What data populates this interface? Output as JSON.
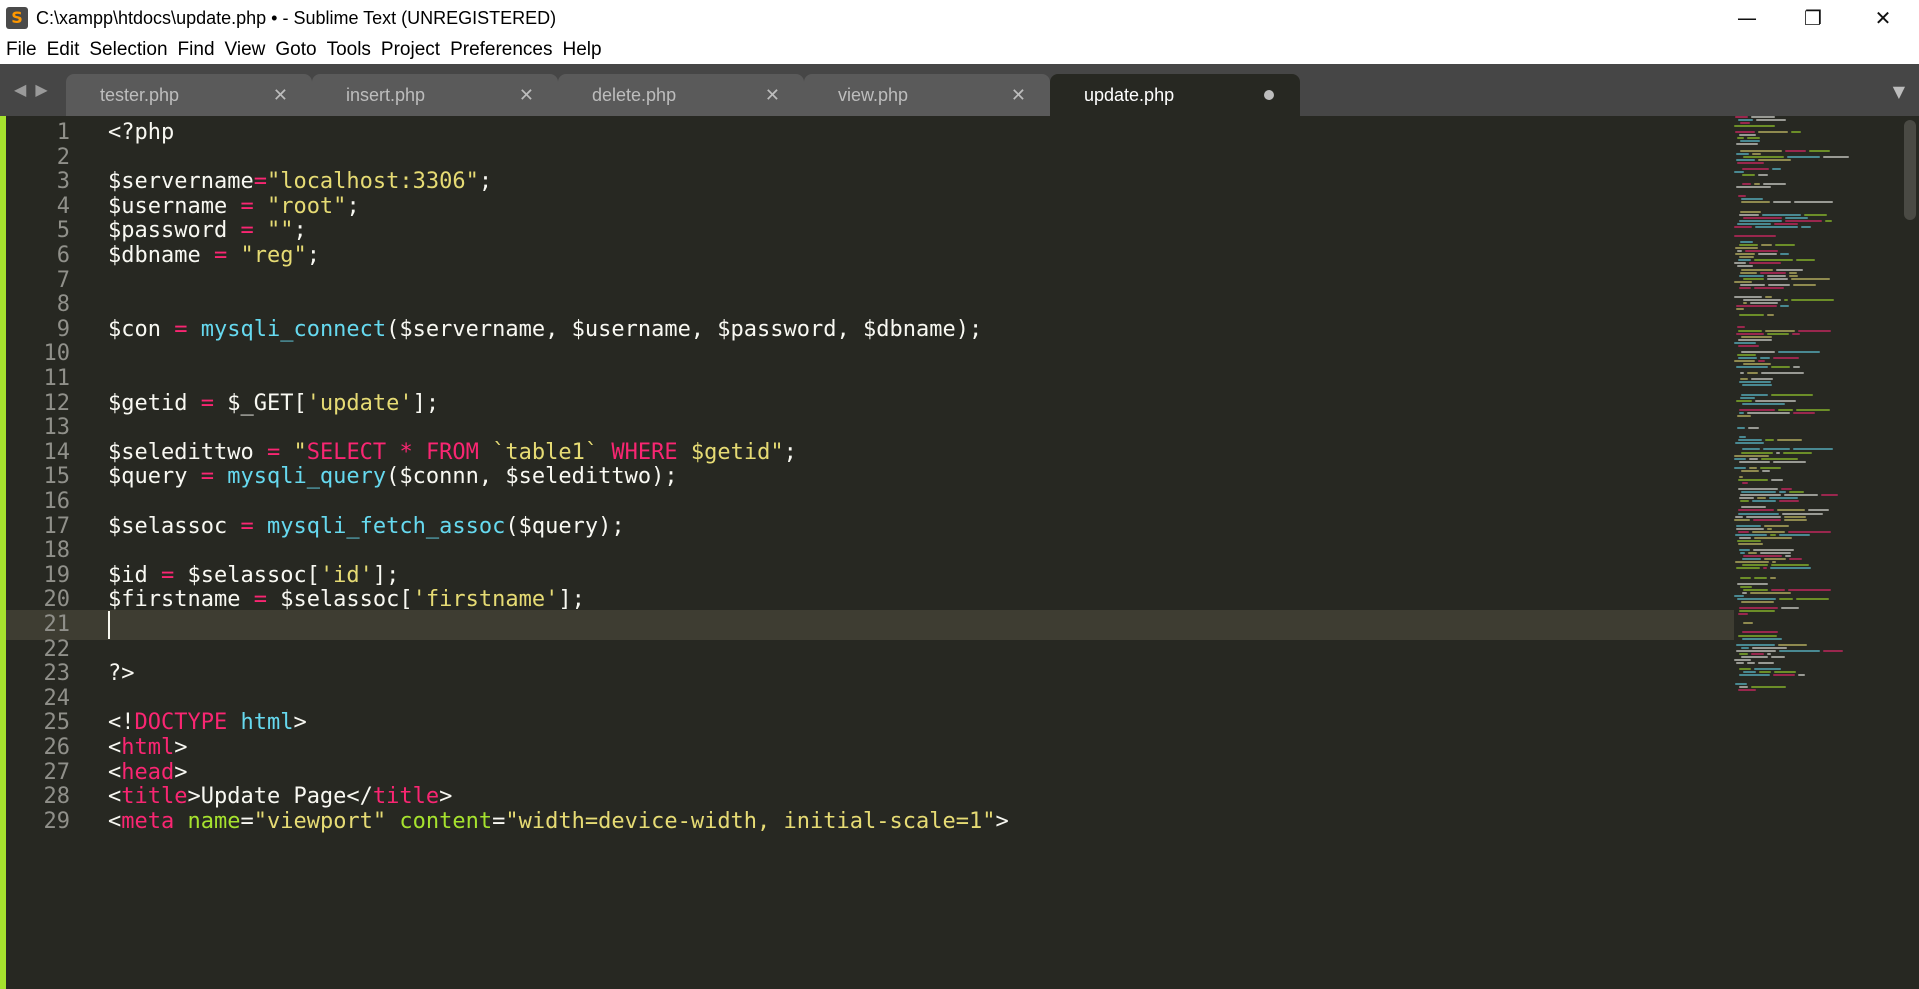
{
  "window": {
    "title": "C:\\xampp\\htdocs\\update.php • - Sublime Text (UNREGISTERED)",
    "app_icon_glyph": "S",
    "controls": {
      "minimize": "—",
      "maximize": "❐",
      "close": "✕"
    }
  },
  "menu": [
    "File",
    "Edit",
    "Selection",
    "Find",
    "View",
    "Goto",
    "Tools",
    "Project",
    "Preferences",
    "Help"
  ],
  "tabs": {
    "nav_glyph": "◀ ▶",
    "dropdown_glyph": "▼",
    "close_glyph": "✕",
    "items": [
      {
        "label": "tester.php",
        "active": false
      },
      {
        "label": "insert.php",
        "active": false
      },
      {
        "label": "delete.php",
        "active": false
      },
      {
        "label": "view.php",
        "active": false
      },
      {
        "label": "update.php",
        "active": true,
        "modified": true
      }
    ]
  },
  "editor": {
    "current_line": 21,
    "lines": [
      {
        "n": "1",
        "tokens": [
          [
            "<?php",
            "var"
          ]
        ]
      },
      {
        "n": "2",
        "tokens": []
      },
      {
        "n": "3",
        "tokens": [
          [
            "$servername",
            "var"
          ],
          [
            "=",
            "op"
          ],
          [
            "\"localhost:3306\"",
            "str"
          ],
          [
            ";",
            "var"
          ]
        ]
      },
      {
        "n": "4",
        "tokens": [
          [
            "$username ",
            "var"
          ],
          [
            "=",
            "op"
          ],
          [
            " ",
            "var"
          ],
          [
            "\"root\"",
            "str"
          ],
          [
            ";",
            "var"
          ]
        ]
      },
      {
        "n": "5",
        "tokens": [
          [
            "$password ",
            "var"
          ],
          [
            "=",
            "op"
          ],
          [
            " ",
            "var"
          ],
          [
            "\"\"",
            "str"
          ],
          [
            ";",
            "var"
          ]
        ]
      },
      {
        "n": "6",
        "tokens": [
          [
            "$dbname ",
            "var"
          ],
          [
            "=",
            "op"
          ],
          [
            " ",
            "var"
          ],
          [
            "\"reg\"",
            "str"
          ],
          [
            ";",
            "var"
          ]
        ]
      },
      {
        "n": "7",
        "tokens": []
      },
      {
        "n": "8",
        "tokens": []
      },
      {
        "n": "9",
        "tokens": [
          [
            "$con ",
            "var"
          ],
          [
            "=",
            "op"
          ],
          [
            " ",
            "var"
          ],
          [
            "mysqli_connect",
            "fn"
          ],
          [
            "($servername, $username, $password, $dbname);",
            "var"
          ]
        ]
      },
      {
        "n": "10",
        "tokens": []
      },
      {
        "n": "11",
        "tokens": []
      },
      {
        "n": "12",
        "tokens": [
          [
            "$getid ",
            "var"
          ],
          [
            "=",
            "op"
          ],
          [
            " $_GET[",
            "var"
          ],
          [
            "'update'",
            "str"
          ],
          [
            "];",
            "var"
          ]
        ]
      },
      {
        "n": "13",
        "tokens": []
      },
      {
        "n": "14",
        "tokens": [
          [
            "$seledittwo ",
            "var"
          ],
          [
            "=",
            "op"
          ],
          [
            " ",
            "var"
          ],
          [
            "\"",
            "str"
          ],
          [
            "SELECT",
            "kw"
          ],
          [
            " ",
            "str"
          ],
          [
            "*",
            "kw"
          ],
          [
            " ",
            "str"
          ],
          [
            "FROM",
            "kw"
          ],
          [
            " `table1` ",
            "str"
          ],
          [
            "WHERE",
            "kw"
          ],
          [
            " $getid\"",
            "str"
          ],
          [
            ";",
            "var"
          ]
        ]
      },
      {
        "n": "15",
        "tokens": [
          [
            "$query ",
            "var"
          ],
          [
            "=",
            "op"
          ],
          [
            " ",
            "var"
          ],
          [
            "mysqli_query",
            "fn"
          ],
          [
            "($connn, $seledittwo);",
            "var"
          ]
        ]
      },
      {
        "n": "16",
        "tokens": []
      },
      {
        "n": "17",
        "tokens": [
          [
            "$selassoc ",
            "var"
          ],
          [
            "=",
            "op"
          ],
          [
            " ",
            "var"
          ],
          [
            "mysqli_fetch_assoc",
            "fn"
          ],
          [
            "($query);",
            "var"
          ]
        ]
      },
      {
        "n": "18",
        "tokens": []
      },
      {
        "n": "19",
        "tokens": [
          [
            "$id ",
            "var"
          ],
          [
            "=",
            "op"
          ],
          [
            " $selassoc[",
            "var"
          ],
          [
            "'id'",
            "str"
          ],
          [
            "];",
            "var"
          ]
        ]
      },
      {
        "n": "20",
        "tokens": [
          [
            "$firstname ",
            "var"
          ],
          [
            "=",
            "op"
          ],
          [
            " $selassoc[",
            "var"
          ],
          [
            "'firstname'",
            "str"
          ],
          [
            "];",
            "var"
          ]
        ]
      },
      {
        "n": "21",
        "tokens": []
      },
      {
        "n": "22",
        "tokens": []
      },
      {
        "n": "23",
        "tokens": [
          [
            "?>",
            "var"
          ]
        ]
      },
      {
        "n": "24",
        "tokens": []
      },
      {
        "n": "25",
        "tokens": [
          [
            "<!",
            "var"
          ],
          [
            "DOCTYPE",
            "tag"
          ],
          [
            " ",
            "var"
          ],
          [
            "html",
            "fn"
          ],
          [
            ">",
            "var"
          ]
        ]
      },
      {
        "n": "26",
        "tokens": [
          [
            "<",
            "var"
          ],
          [
            "html",
            "tag"
          ],
          [
            ">",
            "var"
          ]
        ]
      },
      {
        "n": "27",
        "tokens": [
          [
            "<",
            "var"
          ],
          [
            "head",
            "tag"
          ],
          [
            ">",
            "var"
          ]
        ]
      },
      {
        "n": "28",
        "tokens": [
          [
            "<",
            "var"
          ],
          [
            "title",
            "tag"
          ],
          [
            ">Update Page</",
            "var"
          ],
          [
            "title",
            "tag"
          ],
          [
            ">",
            "var"
          ]
        ]
      },
      {
        "n": "29",
        "tokens": [
          [
            "<",
            "var"
          ],
          [
            "meta",
            "tag"
          ],
          [
            " ",
            "var"
          ],
          [
            "name",
            "attr"
          ],
          [
            "=",
            "var"
          ],
          [
            "\"viewport\"",
            "str"
          ],
          [
            " ",
            "var"
          ],
          [
            "content",
            "attr"
          ],
          [
            "=",
            "var"
          ],
          [
            "\"width=device-width, initial-scale=1\"",
            "str"
          ],
          [
            ">",
            "var"
          ]
        ]
      }
    ]
  },
  "colors": {
    "background": "#272822",
    "keyword": "#f92672",
    "string": "#e6db74",
    "function": "#66d9ef",
    "attribute": "#a6e22e",
    "text": "#f8f8f2"
  }
}
